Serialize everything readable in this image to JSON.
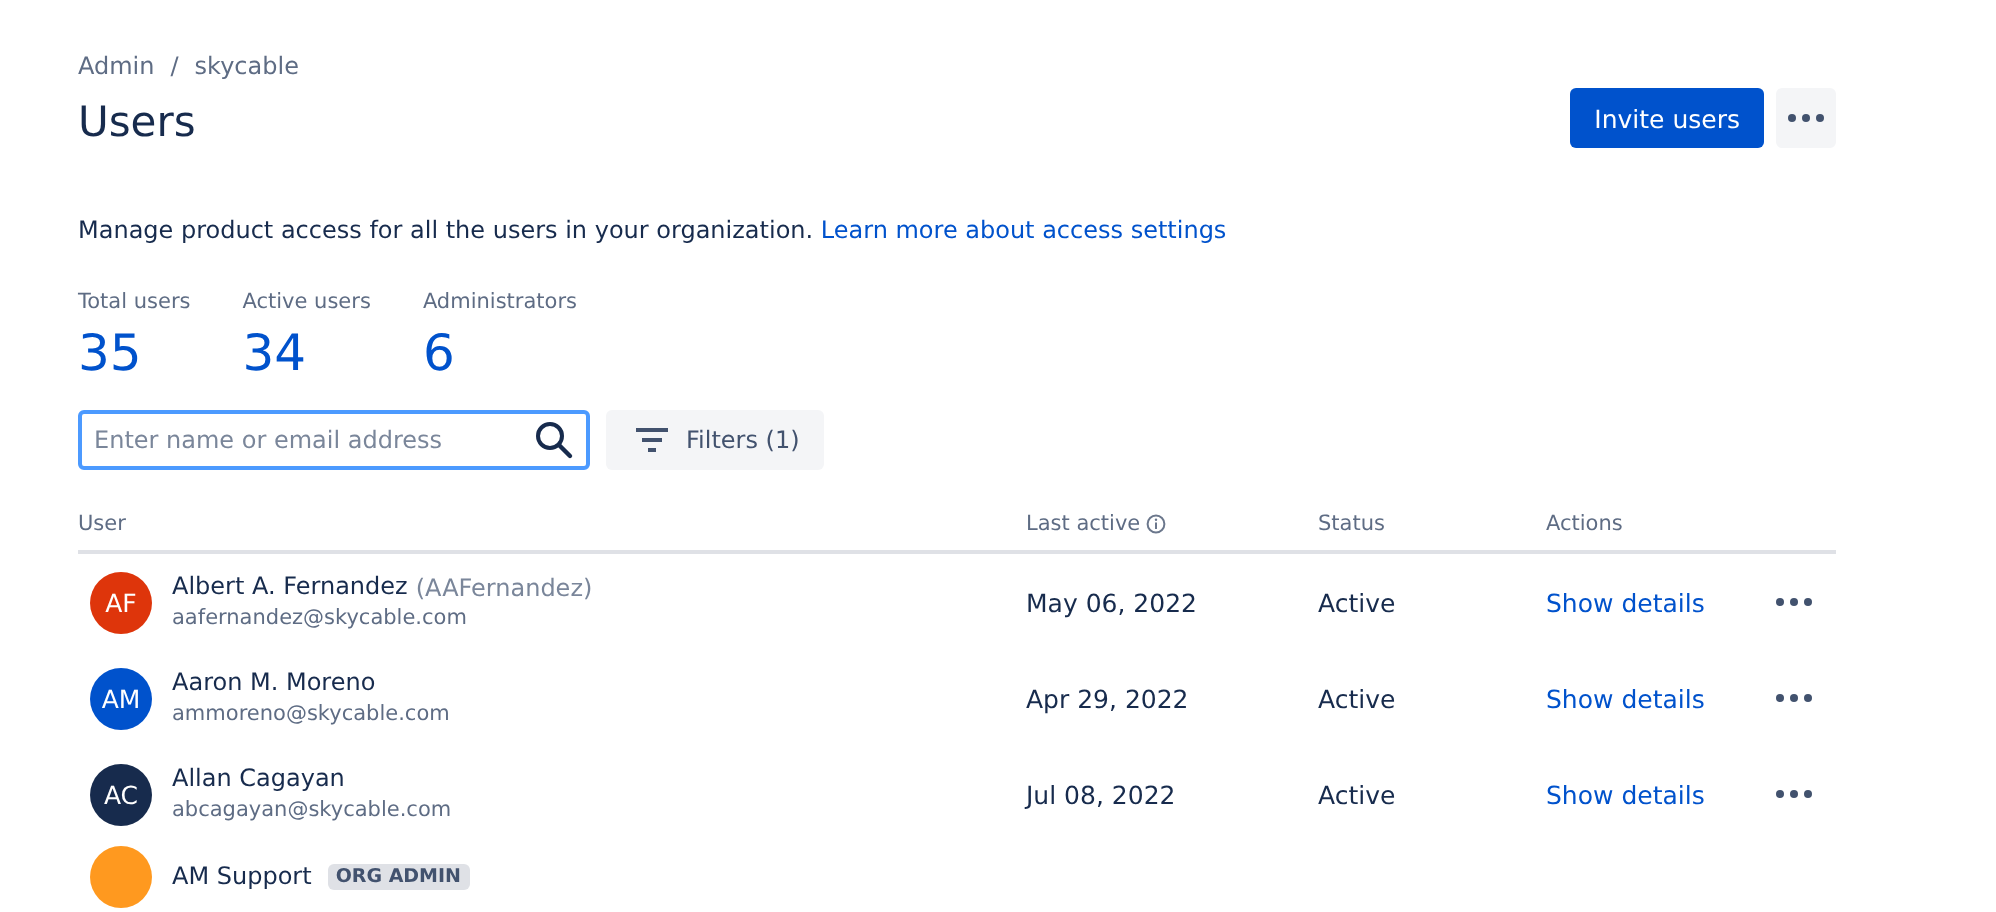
{
  "breadcrumb": {
    "items": [
      "Admin",
      "skycable"
    ],
    "separator": "/"
  },
  "title": "Users",
  "invite_button": "Invite users",
  "description": {
    "text": "Manage product access for all the users in your organization.",
    "link": "Learn more about access settings"
  },
  "stats": [
    {
      "label": "Total users",
      "value": "35"
    },
    {
      "label": "Active users",
      "value": "34"
    },
    {
      "label": "Administrators",
      "value": "6"
    }
  ],
  "search": {
    "placeholder": "Enter name or email address"
  },
  "filters_button": "Filters (1)",
  "table": {
    "columns": [
      "User",
      "Last active",
      "Status",
      "Actions"
    ],
    "rows": [
      {
        "initials": "AF",
        "color": "#de350b",
        "name": "Albert A. Fernandez",
        "username": "(AAFernandez)",
        "email": "aafernandez@skycable.com",
        "last_active": "May 06, 2022",
        "status": "Active",
        "action": "Show details"
      },
      {
        "initials": "AM",
        "color": "#0052cc",
        "name": "Aaron M. Moreno",
        "email": "ammoreno@skycable.com",
        "last_active": "Apr 29, 2022",
        "status": "Active",
        "action": "Show details"
      },
      {
        "initials": "AC",
        "color": "#172b4d",
        "name": "Allan Cagayan",
        "email": "abcagayan@skycable.com",
        "last_active": "Jul 08, 2022",
        "status": "Active",
        "action": "Show details"
      },
      {
        "color": "#ff991f",
        "name": "AM Support",
        "badge": "ORG ADMIN"
      }
    ]
  }
}
